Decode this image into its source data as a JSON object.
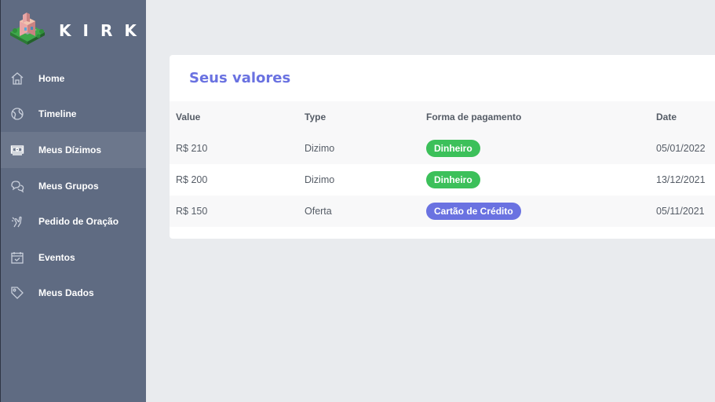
{
  "brand": {
    "name": "KIRK",
    "logo_icon": "isometric-church-icon"
  },
  "sidebar": {
    "items": [
      {
        "label": "Home",
        "icon": "home-icon"
      },
      {
        "label": "Timeline",
        "icon": "globe-icon"
      },
      {
        "label": "Meus Dízimos",
        "icon": "money-icon"
      },
      {
        "label": "Meus Grupos",
        "icon": "chat-icon"
      },
      {
        "label": "Pedido de Oração",
        "icon": "hand-icon"
      },
      {
        "label": "Eventos",
        "icon": "calendar-check-icon"
      },
      {
        "label": "Meus Dados",
        "icon": "tag-icon"
      }
    ],
    "active_index": 2
  },
  "main": {
    "title": "Seus valores",
    "columns": [
      "Value",
      "Type",
      "Forma de pagamento",
      "Date"
    ],
    "rows": [
      {
        "value": "R$ 210",
        "type": "Dizimo",
        "payment": "Dinheiro",
        "payment_color": "#3cc05a",
        "date": "05/01/2022"
      },
      {
        "value": "R$ 200",
        "type": "Dizimo",
        "payment": "Dinheiro",
        "payment_color": "#3cc05a",
        "date": "13/12/2021"
      },
      {
        "value": "R$ 150",
        "type": "Oferta",
        "payment": "Cartão de Crédito",
        "payment_color": "#6a72e1",
        "date": "05/11/2021"
      }
    ]
  },
  "colors": {
    "sidebar": "#5f6b82",
    "accent": "#6a72e1",
    "success": "#3cc05a"
  }
}
